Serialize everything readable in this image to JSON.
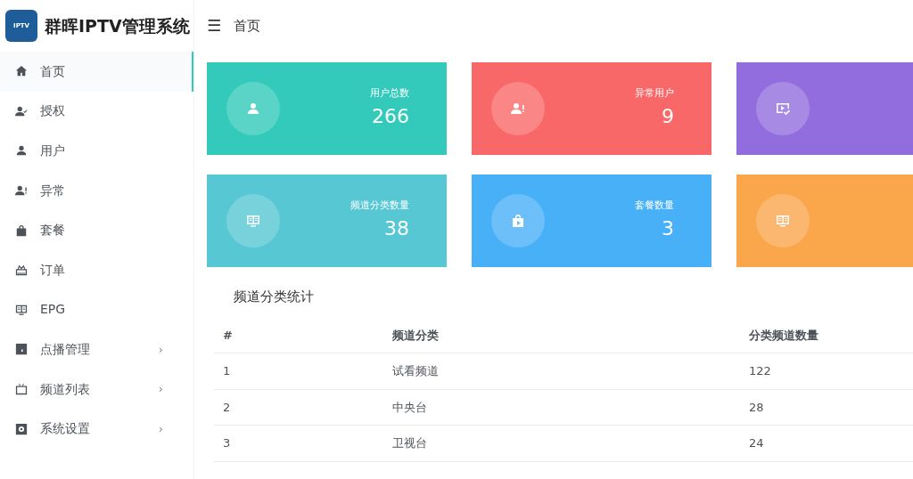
{
  "brand": {
    "title": "群晖IPTV管理系统",
    "logo_text": "IPTV"
  },
  "header": {
    "menu_icon": "☰",
    "breadcrumb": "首页"
  },
  "sidebar": {
    "items": [
      {
        "label": "首页",
        "selected": true
      },
      {
        "label": "授权",
        "selected": false
      },
      {
        "label": "用户",
        "selected": false
      },
      {
        "label": "异常",
        "selected": false
      },
      {
        "label": "套餐",
        "selected": false
      },
      {
        "label": "订单",
        "selected": false
      },
      {
        "label": "EPG",
        "selected": false
      },
      {
        "label": "点播管理",
        "selected": false,
        "arrow": "›"
      },
      {
        "label": "频道列表",
        "selected": false,
        "arrow": "›"
      },
      {
        "label": "系统设置",
        "selected": false,
        "arrow": "›"
      }
    ]
  },
  "stat_cards": [
    {
      "title": "用户总数",
      "value": "266",
      "color": "#33cabb"
    },
    {
      "title": "异常用户",
      "value": "9",
      "color": "#f96868"
    },
    {
      "color": "#926dde"
    },
    {
      "title": "频道分类数量",
      "value": "38",
      "color": "#57c7d4"
    },
    {
      "title": "套餐数量",
      "value": "3",
      "color": "#48b0f7"
    },
    {
      "color": "#faa64b"
    }
  ],
  "table": {
    "title": "频道分类统计",
    "columns": [
      "#",
      "频道分类",
      "分类频道数量"
    ],
    "rows": [
      [
        "1",
        "试看频道",
        "122"
      ],
      [
        "2",
        "中央台",
        "28"
      ],
      [
        "3",
        "卫视台",
        "24"
      ]
    ]
  }
}
